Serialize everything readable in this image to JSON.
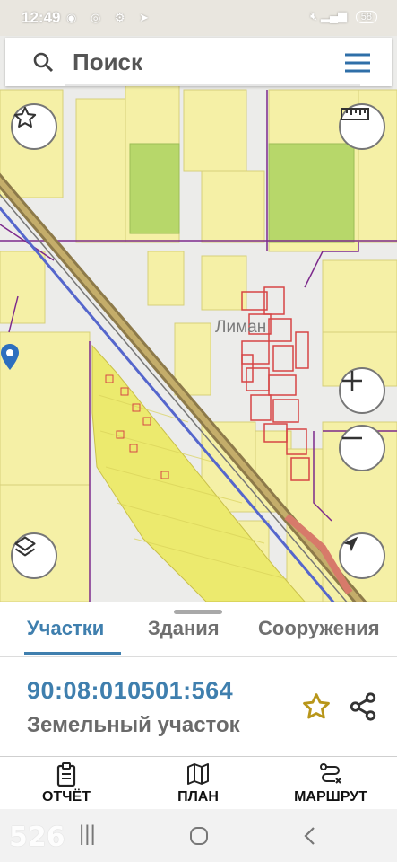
{
  "status": {
    "time": "12:49",
    "notification_icons": [
      "whatsapp-icon",
      "instagram-icon",
      "settings-icon",
      "send-icon"
    ],
    "right_icons": [
      "mute-icon",
      "signal-icon"
    ],
    "battery": "58"
  },
  "search": {
    "placeholder": "Поиск",
    "search_icon": "search-icon",
    "menu_icon": "hamburger-menu-icon"
  },
  "map": {
    "place_label": "Лиман",
    "controls": [
      "favorite-star-icon",
      "ruler-icon",
      "zoom-in-icon",
      "zoom-out-icon",
      "layers-icon",
      "my-location-icon"
    ],
    "colors": {
      "parcel_fill": "#f5f0a6",
      "selected_parcel": "#ecea6e",
      "building_outline": "#d64545",
      "boundary": "#7d2a8c",
      "road": "#8d7a4a",
      "green": "#b7d76a"
    }
  },
  "tabs": [
    {
      "label": "Участки",
      "active": true
    },
    {
      "label": "Здания",
      "active": false
    },
    {
      "label": "Сооружения",
      "active": false
    }
  ],
  "parcel": {
    "cadastral_number": "90:08:010501:564",
    "type": "Земельный участок"
  },
  "actions": {
    "report": "ОТЧЁТ",
    "plan": "ПЛАН",
    "route": "МАРШРУТ"
  },
  "navbar": {
    "watermark_number": "526"
  },
  "accent": "#3f7fae"
}
